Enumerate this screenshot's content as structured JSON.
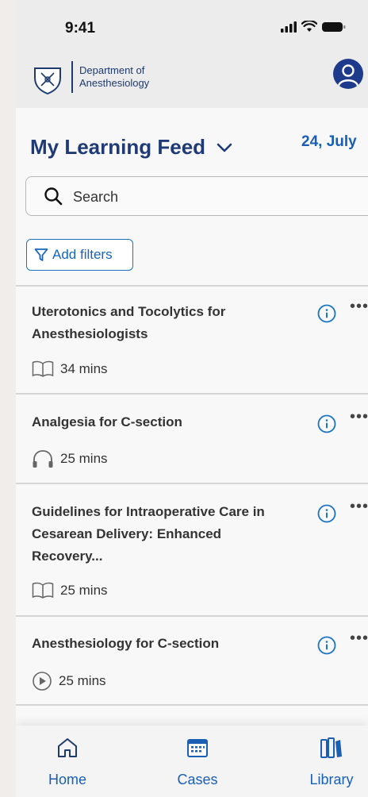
{
  "status": {
    "time": "9:41"
  },
  "header": {
    "dept_line1": "Department of",
    "dept_line2": "Anesthesiology"
  },
  "feed": {
    "title": "My Learning Feed",
    "date": "24, July"
  },
  "search": {
    "placeholder": "Search"
  },
  "filters": {
    "label": "Add filters"
  },
  "items": [
    {
      "title": "Uterotonics and Tocolytics for Anesthesiologists",
      "duration": "34 mins",
      "type_icon": "book-icon"
    },
    {
      "title": "Analgesia for C-section",
      "duration": "25 mins",
      "type_icon": "headphones-icon"
    },
    {
      "title": " Guidelines for Intraoperative Care in Cesarean Delivery: Enhanced Recovery...",
      "duration": "25 mins",
      "type_icon": "book-icon"
    },
    {
      "title": "Anesthesiology for C-section",
      "duration": "25 mins",
      "type_icon": "play-icon"
    }
  ],
  "nav": {
    "home": "Home",
    "cases": "Cases",
    "library": "Library"
  },
  "colors": {
    "brand_navy": "#1f3a75",
    "accent_blue": "#1a5fb4",
    "info_blue": "#1a74c4"
  }
}
